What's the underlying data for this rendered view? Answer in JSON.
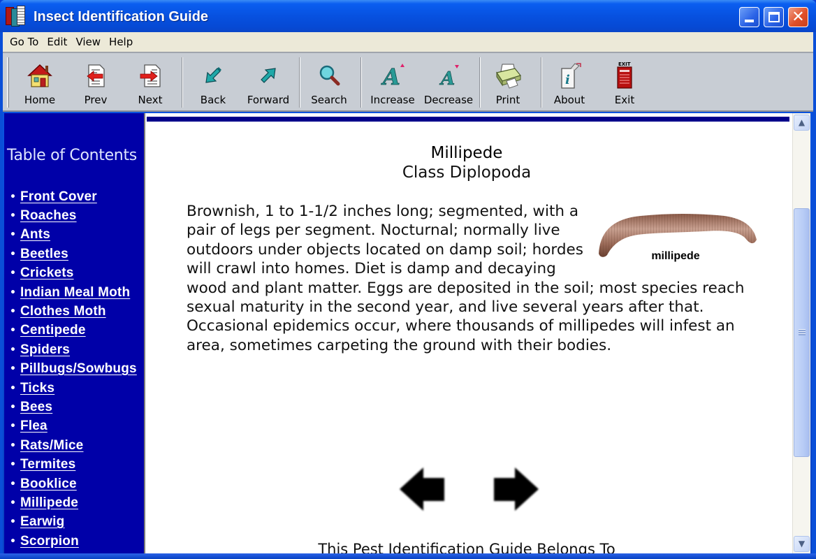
{
  "window": {
    "title": "Insect Identification Guide",
    "controls": {
      "minimize": "minimize",
      "maximize": "maximize",
      "close": "close"
    }
  },
  "menu": [
    "Go To",
    "Edit",
    "View",
    "Help"
  ],
  "toolbar": {
    "buttons": [
      {
        "label": "Home",
        "icon": "home-icon"
      },
      {
        "label": "Prev",
        "icon": "prev-page-icon"
      },
      {
        "label": "Next",
        "icon": "next-page-icon"
      },
      {
        "label": "Back",
        "icon": "back-arrow-icon"
      },
      {
        "label": "Forward",
        "icon": "forward-arrow-icon"
      },
      {
        "label": "Search",
        "icon": "magnifier-icon"
      },
      {
        "label": "Increase",
        "icon": "font-increase-icon"
      },
      {
        "label": "Decrease",
        "icon": "font-decrease-icon"
      },
      {
        "label": "Print",
        "icon": "printer-icon"
      },
      {
        "label": "About",
        "icon": "info-icon"
      },
      {
        "label": "Exit",
        "icon": "exit-icon",
        "icon_text": "EXIT"
      }
    ]
  },
  "sidebar": {
    "title": "Table of Contents",
    "bullet": "•",
    "items": [
      "Front Cover",
      "Roaches",
      "Ants",
      "Beetles",
      "Crickets",
      "Indian Meal Moth",
      "Clothes Moth",
      "Centipede",
      "Spiders",
      "Pillbugs/Sowbugs",
      "Ticks",
      "Bees",
      "Flea",
      "Rats/Mice",
      "Termites",
      "Booklice",
      "Millipede",
      "Earwig",
      "Scorpion"
    ]
  },
  "article": {
    "name": "Millipede",
    "class": "Class Diplopoda",
    "image_caption": "millipede",
    "description": "Brownish, 1 to 1-1/2 inches long; segmented, with a pair of legs per segment. Nocturnal; normally live outdoors under objects located on damp soil; hordes will crawl into homes. Diet is damp and decaying wood and plant matter. Eggs are deposited in the soil; most species reach sexual maturity in the second year, and live several years after that. Occasional epidemics occur, where thousands of millipedes will infest an area, sometimes carpeting the ground with their bodies.",
    "footer": "This Pest Identification Guide Belongs To"
  },
  "scrollbar": {
    "up": "▲",
    "down": "▼",
    "position_fraction": 0.25
  },
  "colors": {
    "titlebar": "#0751e0",
    "sidebar_bg": "#0000a8",
    "toolbar_bg": "#c8cdd4",
    "menubar_bg": "#ece9d8",
    "accent_bar": "#00008b"
  }
}
